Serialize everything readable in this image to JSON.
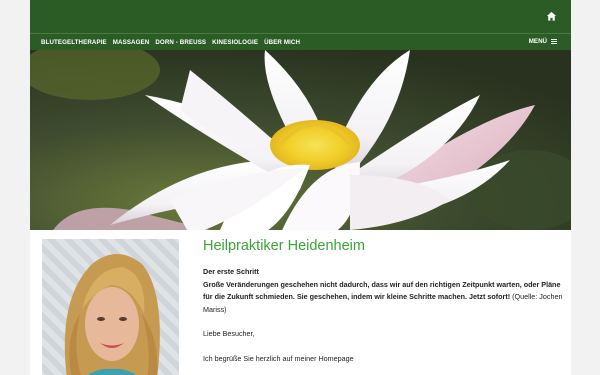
{
  "header": {
    "home_icon": "home-icon"
  },
  "nav": {
    "items": [
      {
        "label": "BLUTEGELTHERAPIE"
      },
      {
        "label": "MASSAGEN"
      },
      {
        "label": "DORN - BREUSS"
      },
      {
        "label": "KINESIOLOGIE"
      },
      {
        "label": "ÜBER MICH"
      }
    ],
    "menu_label": "MENÜ",
    "menu_icon": "hamburger-icon"
  },
  "colors": {
    "brand_green": "#2c5c26",
    "heading_green": "#3aa33a"
  },
  "main": {
    "title": "Heilpraktiker Heidenheim",
    "subtitle": "Der erste Schritt",
    "quote": "Große Veränderungen geschehen nicht dadurch, dass wir auf den richtigen Zeitpunkt warten, oder Pläne für die Zukunft schmieden. Sie geschehen, indem wir kleine Schritte machen. Jetzt sofort!",
    "quote_source": " (Quelle: Jochen Mariss)",
    "greeting": "Liebe Besucher,",
    "partial": "Ich begrüße Sie herzlich auf meiner Homepage"
  }
}
